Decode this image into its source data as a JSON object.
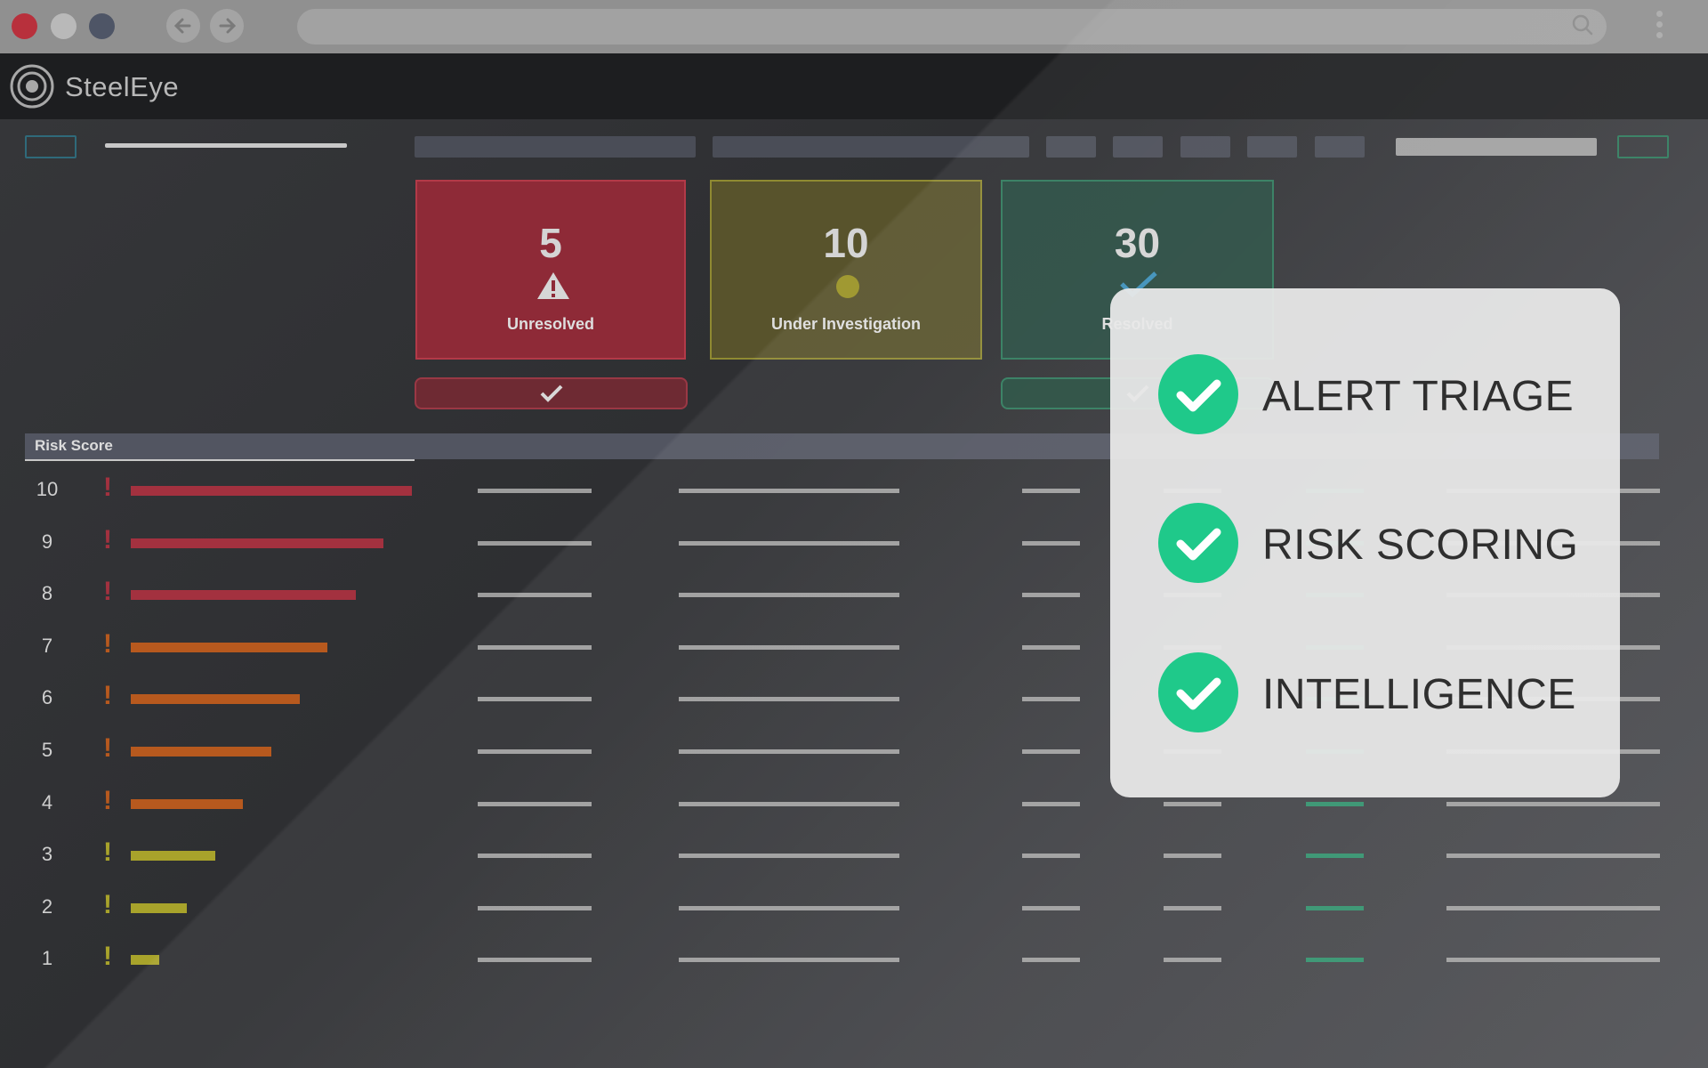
{
  "header": {
    "brand": "SteelEye"
  },
  "cards": [
    {
      "count": "5",
      "label": "Unresolved",
      "status": "unresolved",
      "color": "#8e2a37",
      "icon": "warning-icon"
    },
    {
      "count": "10",
      "label": "Under Investigation",
      "status": "under-investigation",
      "color": "#6b6330",
      "icon": "circle-icon"
    },
    {
      "count": "30",
      "label": "Resolved",
      "status": "resolved",
      "color": "#285c4a",
      "icon": "check-icon"
    }
  ],
  "table": {
    "header_label": "Risk Score",
    "rows": [
      {
        "score": "10",
        "level": 10,
        "color": "#a3313f"
      },
      {
        "score": "9",
        "level": 9,
        "color": "#a3313f"
      },
      {
        "score": "8",
        "level": 8,
        "color": "#a3313f"
      },
      {
        "score": "7",
        "level": 7,
        "color": "#b7591e"
      },
      {
        "score": "6",
        "level": 6,
        "color": "#b7591e"
      },
      {
        "score": "5",
        "level": 5,
        "color": "#b7591e"
      },
      {
        "score": "4",
        "level": 4,
        "color": "#b7591e"
      },
      {
        "score": "3",
        "level": 3,
        "color": "#a8a32b"
      },
      {
        "score": "2",
        "level": 2,
        "color": "#a8a32b"
      },
      {
        "score": "1",
        "level": 1,
        "color": "#a8a32b"
      }
    ]
  },
  "features": [
    {
      "label": "ALERT TRIAGE"
    },
    {
      "label": "RISK SCORING"
    },
    {
      "label": "INTELLIGENCE"
    }
  ],
  "colors": {
    "accent_check": "#1fc98a",
    "close": "#b8303c",
    "minimize": "#b9b9b9",
    "maximize": "#4e5566"
  }
}
